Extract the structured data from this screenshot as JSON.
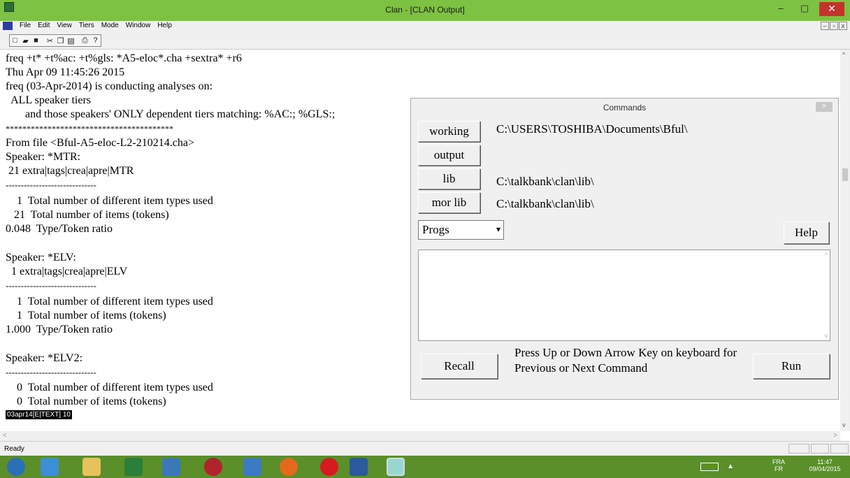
{
  "window": {
    "title": "Clan - [CLAN Output]",
    "min": "–",
    "max": "▢",
    "close": "✕"
  },
  "menu": [
    "File",
    "Edit",
    "View",
    "Tiers",
    "Mode",
    "Window",
    "Help"
  ],
  "mdi": [
    "–",
    "▫",
    "x"
  ],
  "toolbar": [
    "new-icon",
    "open-icon",
    "save-icon",
    "cut-icon",
    "copy-icon",
    "paste-icon",
    "print-icon",
    "help-icon"
  ],
  "output": {
    "lines": [
      "freq +t* +t%ac: +t%gls: *A5-eloc*.cha +sextra* +r6",
      "Thu Apr 09 11:45:26 2015",
      "freq (03-Apr-2014) is conducting analyses on:",
      "  ALL speaker tiers",
      "       and those speakers' ONLY dependent tiers matching: %AC:; %GLS:;",
      "****************************************",
      "From file <Bful-A5-eloc-L2-210214.cha>",
      "Speaker: *MTR:",
      " 21 extra|tags|crea|apre|MTR",
      "------------------------------",
      "    1  Total number of different item types used",
      "   21  Total number of items (tokens)",
      "0.048  Type/Token ratio",
      "",
      "Speaker: *ELV:",
      "  1 extra|tags|crea|apre|ELV",
      "------------------------------",
      "    1  Total number of different item types used",
      "    1  Total number of items (tokens)",
      "1.000  Type/Token ratio",
      "",
      "Speaker: *ELV2:",
      "------------------------------",
      "    0  Total number of different item types used",
      "    0  Total number of items (tokens)"
    ],
    "status_tag": "03apr14[E|TEXT]   10"
  },
  "status": "Ready",
  "commands": {
    "title": "Commands",
    "close": "×",
    "working_label": "working",
    "working_path": "C:\\USERS\\TOSHIBA\\Documents\\Bful\\",
    "output_label": "output",
    "lib_label": "lib",
    "lib_path": "C:\\talkbank\\clan\\lib\\",
    "morlib_label": "mor lib",
    "morlib_path": "C:\\talkbank\\clan\\lib\\",
    "progs_value": "Progs",
    "help_label": "Help",
    "recall_label": "Recall",
    "hint": "Press Up or Down Arrow Key on keyboard for Previous or Next Command",
    "run_label": "Run"
  },
  "tray": {
    "lang": "FRA",
    "lang2": "FR",
    "time": "11:47",
    "date": "09/04/2015"
  }
}
